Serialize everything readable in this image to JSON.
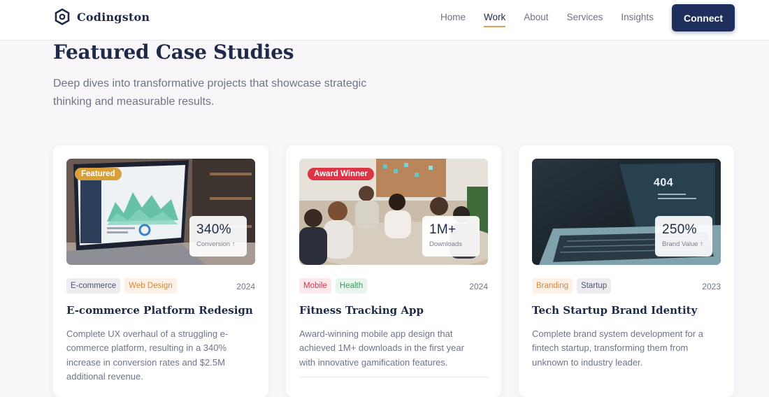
{
  "brand": {
    "name": "Codingston",
    "icon": "hexagon-logo-icon"
  },
  "nav": {
    "items": [
      {
        "label": "Home"
      },
      {
        "label": "Work",
        "active": true
      },
      {
        "label": "About"
      },
      {
        "label": "Services"
      },
      {
        "label": "Insights"
      }
    ],
    "cta_label": "Connect"
  },
  "hero": {
    "title": "Featured Case Studies",
    "subtitle": "Deep dives into transformative projects that showcase strategic thinking and measurable results."
  },
  "colors": {
    "navy": "#1e2f5e",
    "accent_underline": "#d8a05a",
    "featured_badge": "#d8a03a",
    "award_badge": "#dc3545"
  },
  "cards": [
    {
      "badge": "Featured",
      "image": "laptop-analytics-dashboard",
      "stat_value": "340%",
      "stat_label": "Conversion ↑",
      "tags": [
        {
          "label": "E-commerce",
          "style": "gray"
        },
        {
          "label": "Web Design",
          "style": "orange"
        }
      ],
      "year": "2024",
      "title": "E-commerce Platform Redesign",
      "description": "Complete UX overhaul of a struggling e-commerce platform, resulting in a 340% increase in conversion rates and $2.5M additional revenue."
    },
    {
      "badge": "Award Winner",
      "image": "team-meeting-photo",
      "stat_value": "1M+",
      "stat_label": "Downloads",
      "tags": [
        {
          "label": "Mobile",
          "style": "red"
        },
        {
          "label": "Health",
          "style": "green"
        }
      ],
      "year": "2024",
      "title": "Fitness Tracking App",
      "description": "Award-winning mobile app design that achieved 1M+ downloads in the first year with innovative gamification features."
    },
    {
      "badge": "",
      "image": "laptop-404-screen",
      "screen_text": "404",
      "stat_value": "250%",
      "stat_label": "Brand Value ↑",
      "tags": [
        {
          "label": "Branding",
          "style": "orange"
        },
        {
          "label": "Startup",
          "style": "gray"
        }
      ],
      "year": "2023",
      "title": "Tech Startup Brand Identity",
      "description": "Complete brand system development for a fintech startup, transforming them from unknown to industry leader."
    }
  ]
}
